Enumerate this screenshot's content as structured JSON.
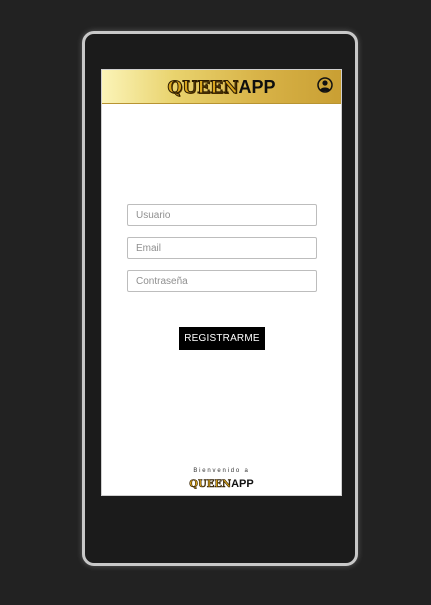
{
  "header": {
    "logo_part1": "QUEEN",
    "logo_part2": "APP",
    "user_icon": "user-circle-icon"
  },
  "form": {
    "username_placeholder": "Usuario",
    "email_placeholder": "Email",
    "password_placeholder": "Contraseña",
    "submit_label": "REGISTRARME"
  },
  "footer": {
    "welcome_text": "Bienvenido a",
    "logo_part1": "QUEEN",
    "logo_part2": "APP"
  },
  "colors": {
    "background": "#222222",
    "header_gold": "#d8b348",
    "button": "#000000",
    "button_text": "#ffffff"
  }
}
